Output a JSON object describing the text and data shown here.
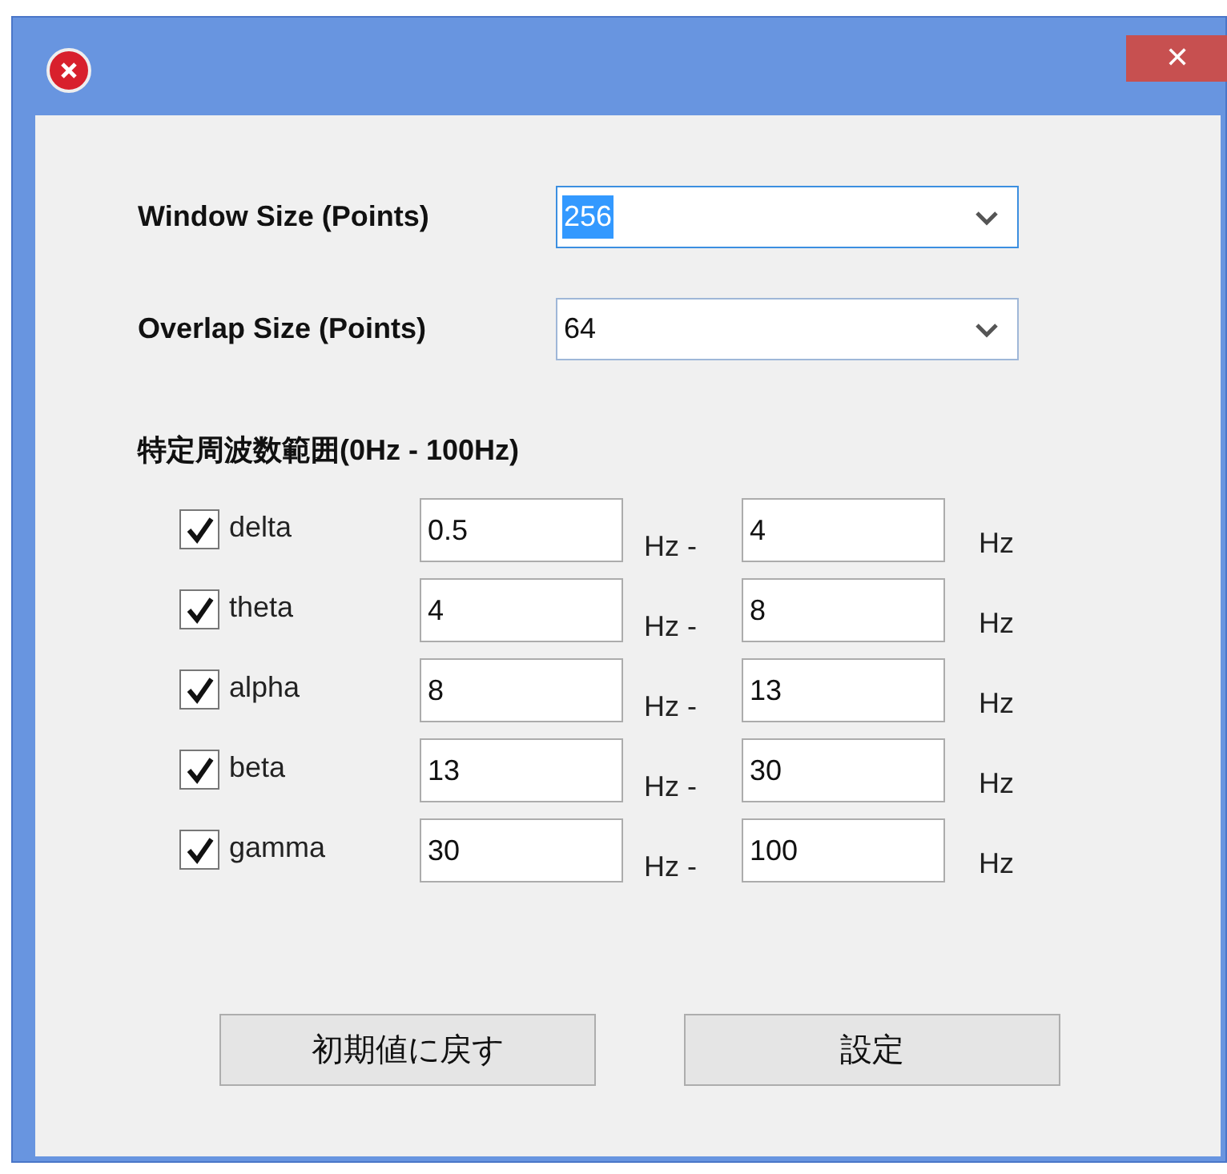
{
  "window": {
    "close": "✕"
  },
  "settings": [
    {
      "label": "Window Size (Points)",
      "value": "256",
      "focused": true,
      "text_selected": true
    },
    {
      "label": "Overlap Size (Points)",
      "value": "64",
      "focused": false,
      "text_selected": false
    }
  ],
  "range": {
    "title": "特定周波数範囲(0Hz - 100Hz)",
    "bands": [
      {
        "name": "delta",
        "checked": true,
        "from": "0.5",
        "sep": "Hz -",
        "to": "4",
        "unit": "Hz"
      },
      {
        "name": "theta",
        "checked": true,
        "from": "4",
        "sep": "Hz -",
        "to": "8",
        "unit": "Hz"
      },
      {
        "name": "alpha",
        "checked": true,
        "from": "8",
        "sep": "Hz -",
        "to": "13",
        "unit": "Hz"
      },
      {
        "name": "beta",
        "checked": true,
        "from": "13",
        "sep": "Hz -",
        "to": "30",
        "unit": "Hz"
      },
      {
        "name": "gamma",
        "checked": true,
        "from": "30",
        "sep": "Hz -",
        "to": "100",
        "unit": "Hz"
      }
    ]
  },
  "buttons": [
    "初期値に戻す",
    "設定"
  ]
}
